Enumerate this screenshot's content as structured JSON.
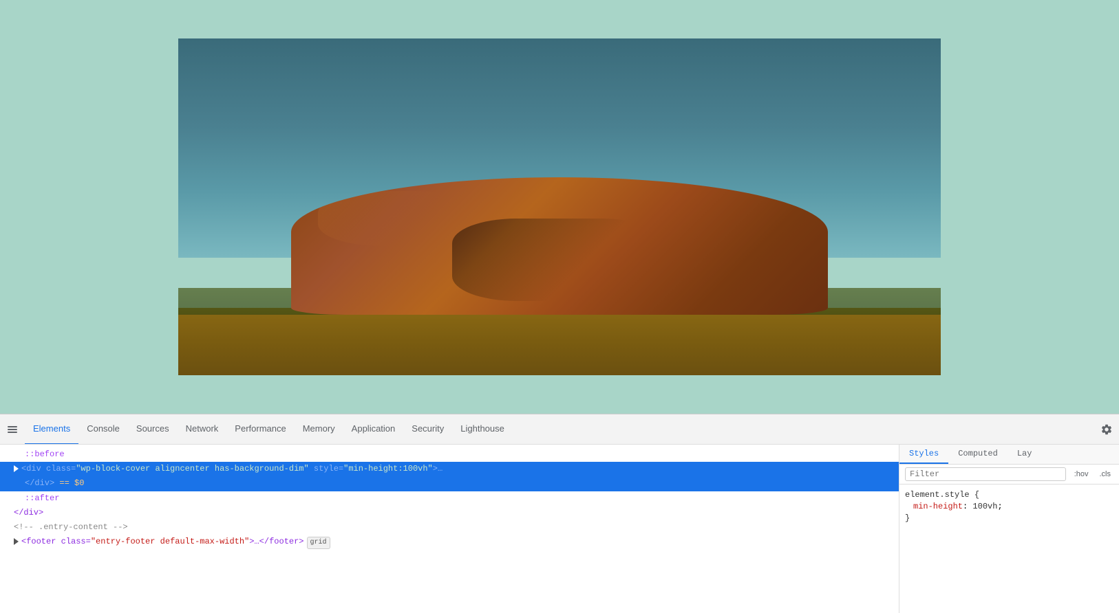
{
  "browser": {
    "viewport_bg": "#a8d5c8"
  },
  "devtools": {
    "tabs": [
      {
        "id": "elements",
        "label": "Elements",
        "active": true
      },
      {
        "id": "console",
        "label": "Console",
        "active": false
      },
      {
        "id": "sources",
        "label": "Sources",
        "active": false
      },
      {
        "id": "network",
        "label": "Network",
        "active": false
      },
      {
        "id": "performance",
        "label": "Performance",
        "active": false
      },
      {
        "id": "memory",
        "label": "Memory",
        "active": false
      },
      {
        "id": "application",
        "label": "Application",
        "active": false
      },
      {
        "id": "security",
        "label": "Security",
        "active": false
      },
      {
        "id": "lighthouse",
        "label": "Lighthouse",
        "active": false
      }
    ],
    "settings_icon": "⚙",
    "panel_icon": "☰"
  },
  "elements_panel": {
    "lines": [
      {
        "indent": 2,
        "content": "::before",
        "type": "pseudo",
        "selected": false
      },
      {
        "indent": 1,
        "content": "div_cover",
        "type": "tag_line",
        "selected": true
      },
      {
        "indent": 2,
        "content": "</div> == $0",
        "type": "close_dollar",
        "selected": true
      },
      {
        "indent": 2,
        "content": "::after",
        "type": "pseudo",
        "selected": false
      },
      {
        "indent": 1,
        "content": "</div>",
        "type": "close",
        "selected": false
      },
      {
        "indent": 1,
        "content": "<!-- .entry-content -->",
        "type": "comment",
        "selected": false
      },
      {
        "indent": 1,
        "content": "footer_line",
        "type": "footer_tag",
        "selected": false
      }
    ]
  },
  "styles_panel": {
    "tabs": [
      {
        "label": "Styles",
        "active": true
      },
      {
        "label": "Computed",
        "active": false
      },
      {
        "label": "Lay",
        "active": false
      }
    ],
    "filter_placeholder": "Filter",
    "filter_hov": ":hov",
    "filter_cls": ".cls",
    "css_rules": [
      {
        "selector": "element.style {",
        "properties": [
          {
            "prop": "min-height",
            "value": "100vh",
            "suffix": ";"
          }
        ],
        "close": "}"
      }
    ]
  }
}
